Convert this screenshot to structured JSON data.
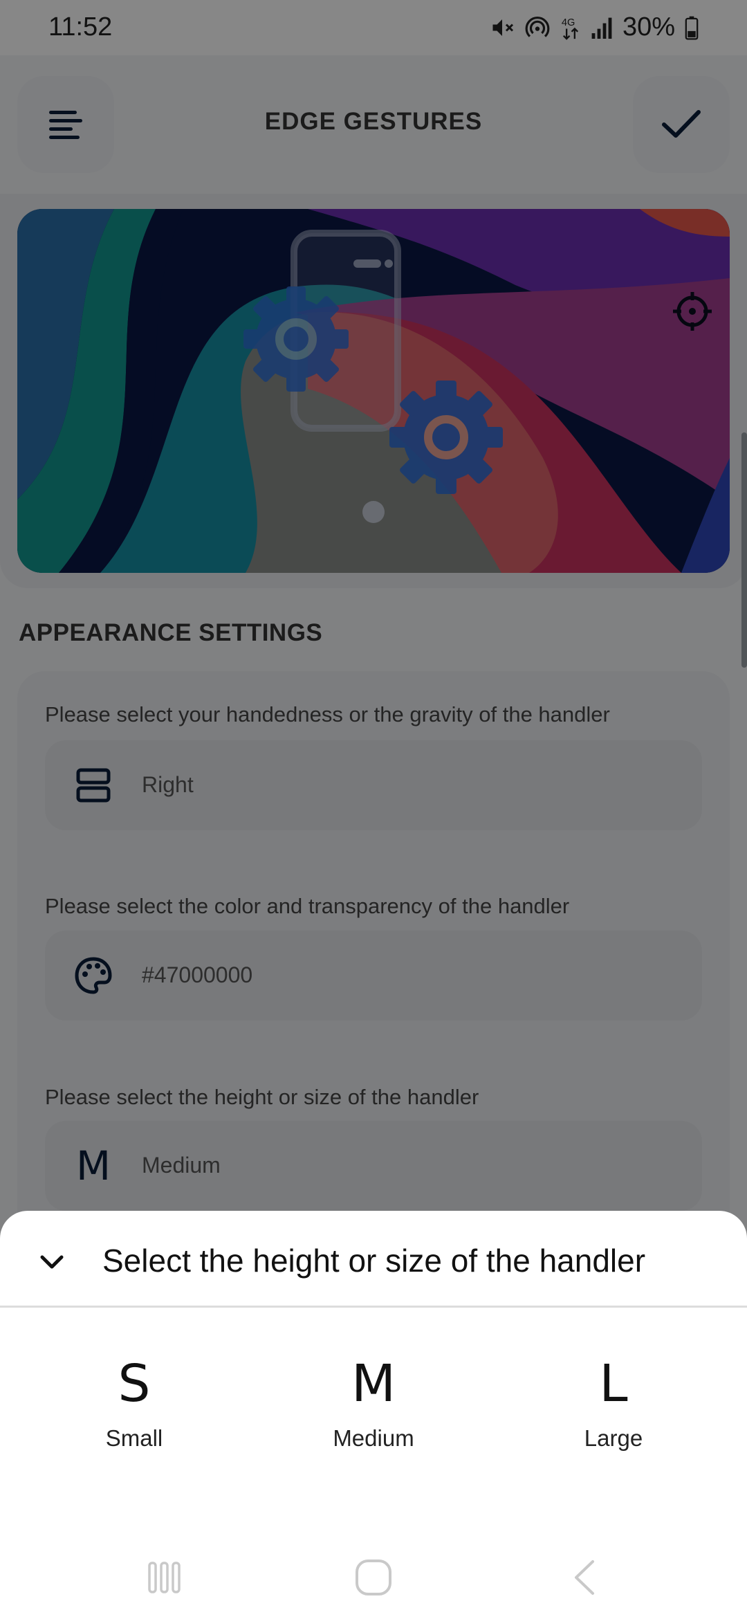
{
  "status_bar": {
    "time": "11:52",
    "battery": "30%",
    "icons": [
      "mute-icon",
      "hotspot-icon",
      "4g-icon",
      "signal-icon",
      "battery-icon"
    ]
  },
  "app_bar": {
    "title": "EDGE GESTURES",
    "menu_icon": "menu-icon",
    "confirm_icon": "check-icon"
  },
  "hero": {
    "illustration": "phone-with-gears",
    "target_icon": "crosshair-icon"
  },
  "appearance": {
    "section_title": "APPEARANCE SETTINGS",
    "handedness": {
      "label": "Please select your handedness or the gravity of the handler",
      "value": "Right",
      "icon": "gravity-icon"
    },
    "color": {
      "label": "Please select the color and transparency of the handler",
      "value": "#47000000",
      "icon": "palette-icon"
    },
    "size": {
      "label": "Please select the height or size of the handler",
      "value": "Medium",
      "icon_letter": "M"
    }
  },
  "sheet": {
    "title": "Select the height or size of the handler",
    "options": [
      {
        "letter": "S",
        "label": "Small"
      },
      {
        "letter": "M",
        "label": "Medium"
      },
      {
        "letter": "L",
        "label": "Large"
      }
    ]
  },
  "colors": {
    "icon_dark": "#0b1d3a",
    "hero_navy": "#0a1745",
    "hero_teal": "#17a3a0",
    "hero_purple": "#6b2fb0",
    "hero_magenta": "#d81b60",
    "gear_blue": "#2f6fd6"
  }
}
